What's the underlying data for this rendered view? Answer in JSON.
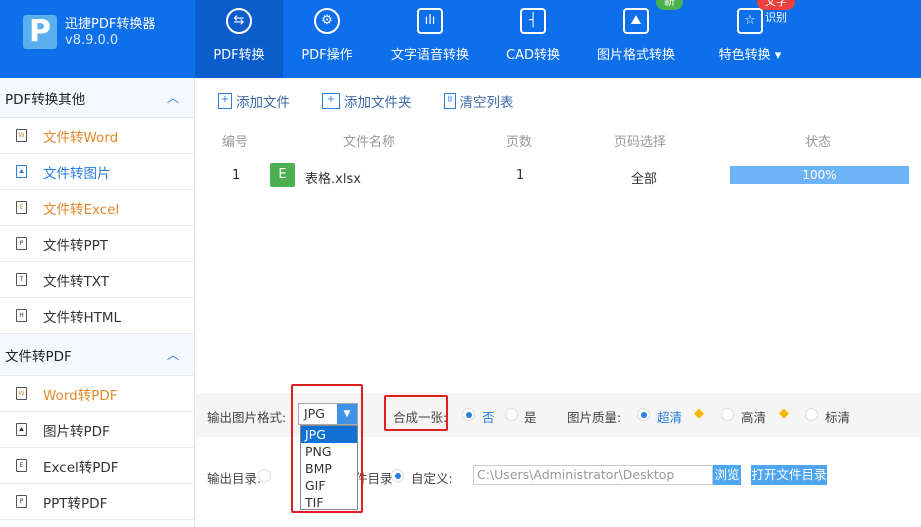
{
  "app": {
    "title": "迅捷PDF转换器",
    "version": "v8.9.0.0",
    "logo": "P"
  },
  "tabs": [
    {
      "label": "PDF转换",
      "active": true
    },
    {
      "label": "PDF操作"
    },
    {
      "label": "文字语音转换"
    },
    {
      "label": "CAD转换"
    },
    {
      "label": "图片格式转换",
      "badge": "新"
    },
    {
      "label": "特色转换",
      "badge": "文字识别"
    }
  ],
  "sidebar": {
    "sections": [
      {
        "title": "PDF转换其他",
        "items": [
          {
            "label": "文件转Word",
            "icon": "W"
          },
          {
            "label": "文件转图片",
            "icon": "img"
          },
          {
            "label": "文件转Excel",
            "icon": "E"
          },
          {
            "label": "文件转PPT",
            "icon": "P"
          },
          {
            "label": "文件转TXT",
            "icon": "T"
          },
          {
            "label": "文件转HTML",
            "icon": "H"
          }
        ]
      },
      {
        "title": "文件转PDF",
        "items": [
          {
            "label": "Word转PDF",
            "icon": "W"
          },
          {
            "label": "图片转PDF",
            "icon": "img"
          },
          {
            "label": "Excel转PDF",
            "icon": "E"
          },
          {
            "label": "PPT转PDF",
            "icon": "P"
          }
        ]
      }
    ]
  },
  "toolbar": {
    "add_file": "添加文件",
    "add_folder": "添加文件夹",
    "clear": "清空列表"
  },
  "table": {
    "headers": [
      "编号",
      "文件名称",
      "页数",
      "页码选择",
      "状态"
    ],
    "rows": [
      {
        "no": "1",
        "type": "E",
        "name": "表格.xlsx",
        "pages": "1",
        "range": "全部",
        "status": "100%",
        "progress": 100
      }
    ]
  },
  "options": {
    "format_label": "输出图片格式:",
    "format_value": "JPG",
    "format_options": [
      "JPG",
      "PNG",
      "BMP",
      "GIF",
      "TIF"
    ],
    "merge_label": "合成一张:",
    "merge_no": "否",
    "merge_yes": "是",
    "quality_label": "图片质量:",
    "q_super": "超清",
    "q_high": "高清",
    "q_std": "标清",
    "outdir_label": "输出目录:",
    "outdir_orig": "原文件目录",
    "outdir_custom": "自定义:",
    "path": "C:\\Users\\Administrator\\Desktop",
    "browse": "浏览",
    "open_dir": "打开文件目录"
  },
  "colors": {
    "header": "#0d6fea",
    "accent": "#2a7be0",
    "orange": "#e08a2c",
    "highlight": "#e02020"
  }
}
